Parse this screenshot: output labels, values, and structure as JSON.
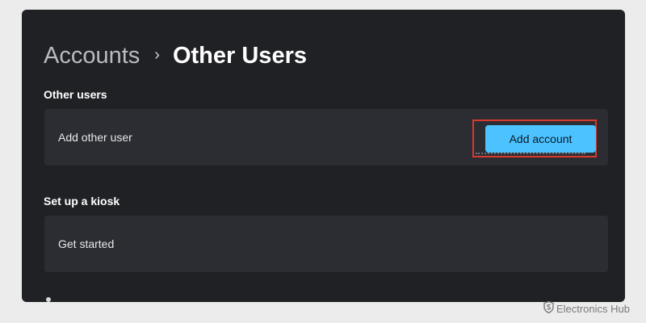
{
  "breadcrumb": {
    "parent": "Accounts",
    "separator": "›",
    "current": "Other Users"
  },
  "sections": {
    "other_users": {
      "label": "Other users",
      "row_label": "Add other user",
      "button_label": "Add account"
    },
    "kiosk": {
      "label": "Set up a kiosk",
      "row_label": "Get started"
    }
  },
  "watermark": {
    "text": "Electronics Hub",
    "icon": "shield-s-logo-icon"
  },
  "colors": {
    "window_bg": "#202124",
    "card_bg": "#2b2d33",
    "accent": "#4cc2ff",
    "highlight_border": "#d83a2e"
  }
}
